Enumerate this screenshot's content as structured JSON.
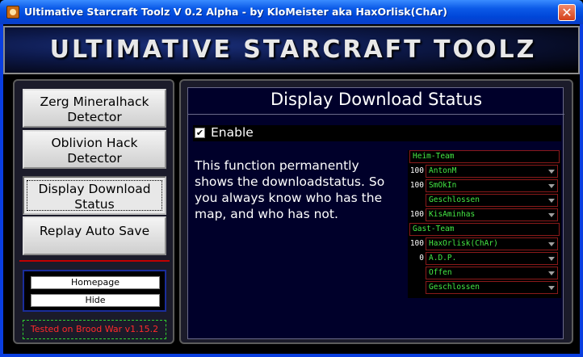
{
  "window": {
    "title": "Ultimative Starcraft Toolz V 0.2 Alpha   -   by  KloMeister aka HaxOrlisk(ChAr)",
    "close_glyph": "✕",
    "icon": "starcraft-app-icon"
  },
  "banner": {
    "text": "ULTIMATIVE STARCRAFT TOOLZ"
  },
  "sidebar": {
    "items": [
      {
        "label": "Zerg Mineralhack Detector",
        "active": false
      },
      {
        "label": "Oblivion Hack Detector",
        "active": false
      },
      {
        "label": "Display Download Status",
        "active": true
      },
      {
        "label": "Replay Auto Save",
        "active": false
      }
    ],
    "links": {
      "homepage": "Homepage",
      "hide": "Hide"
    },
    "tested": "Tested on Brood War v1.15.2"
  },
  "main": {
    "title": "Display Download Status",
    "enable_label": "Enable",
    "enable_checked": true,
    "description": "This function permanently shows the downloadstatus. So you always know who has the map, and who has not."
  },
  "player_list": {
    "rows": [
      {
        "type": "header",
        "label": "Heim-Team"
      },
      {
        "type": "player",
        "num": "100",
        "value": "AntonM"
      },
      {
        "type": "player",
        "num": "100",
        "value": "SmOkIn"
      },
      {
        "type": "player",
        "num": "",
        "value": "Geschlossen"
      },
      {
        "type": "player",
        "num": "100",
        "value": "KisAminhas"
      },
      {
        "type": "header",
        "label": "Gast-Team"
      },
      {
        "type": "player",
        "num": "100",
        "value": "HaxOrlisk(ChAr)"
      },
      {
        "type": "player",
        "num": "0",
        "value": "A.D.P."
      },
      {
        "type": "player",
        "num": "",
        "value": "Offen"
      },
      {
        "type": "player",
        "num": "",
        "value": "Geschlossen"
      }
    ],
    "colors": {
      "text": "#44e844",
      "border": "#8a1a1a"
    }
  },
  "colors": {
    "title_bar": "#0b5ae8",
    "panel_bg": "#00002a",
    "tested_text": "#ff2a2a",
    "tested_border": "#2fd02f"
  }
}
